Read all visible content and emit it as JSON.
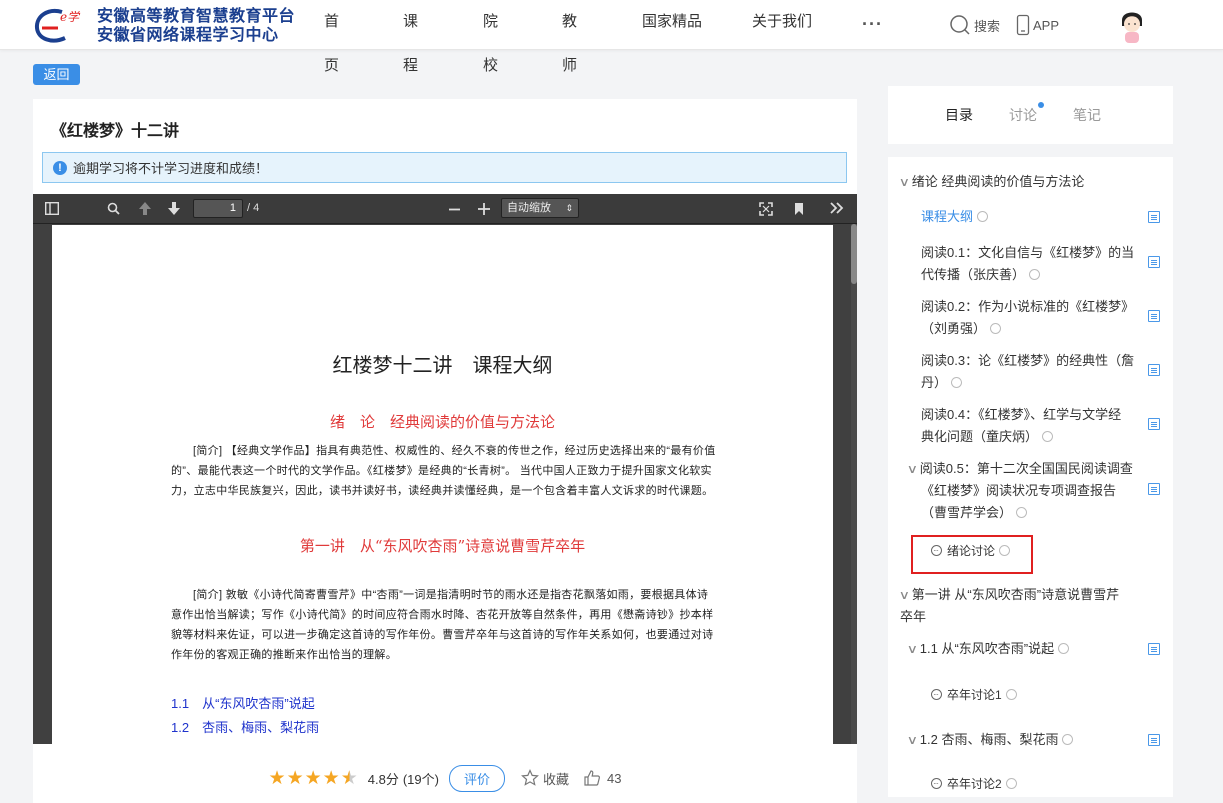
{
  "header": {
    "logo_line1": "安徽高等教育智慧教育平台",
    "logo_line2": "安徽省网络课程学习中心",
    "nav": [
      "首页",
      "课程",
      "院校",
      "教师",
      "国家精品",
      "关于我们"
    ],
    "more": "···",
    "search_label": "搜索",
    "app_label": "APP"
  },
  "back_label": "返回",
  "course": {
    "title": "《红楼梦》十二讲",
    "notice": "逾期学习将不计学习进度和成绩！"
  },
  "pdf": {
    "page_current": "1",
    "page_total": "/ 4",
    "zoom": "自动缩放",
    "doc_title": "红楼梦十二讲　课程大纲",
    "intro_heading": "绪　论　经典阅读的价值与方法论",
    "intro_para": "[简介] 【经典文学作品】指具有典范性、权威性的、经久不衰的传世之作，经过历史选择出来的“最有价值的”、最能代表这一个时代的文学作品。《红楼梦》是经典的“长青树”。 当代中国人正致力于提升国家文化软实力，立志中华民族复兴，因此，读书并读好书，读经典并读懂经典，是一个包含着丰富人文诉求的时代课题。",
    "lecture1_heading": "第一讲　从“东风吹杏雨”诗意说曹雪芹卒年",
    "lecture1_para": "[简介] 敦敏《小诗代简寄曹雪芹》中“杏雨”一词是指清明时节的雨水还是指杏花飘落如雨，要根据具体诗意作出恰当解读；写作《小诗代简》的时间应符合雨水时降、杏花开放等自然条件，再用《懋斋诗钞》抄本样貌等材料来佐证，可以进一步确定这首诗的写作年份。曹雪芹卒年与这首诗的写作年关系如何，也要通过对诗作年份的客观正确的推断来作出恰当的理解。",
    "toc1": "1.1　从“东风吹杏雨”说起",
    "toc2": "1.2　杏雨、梅雨、梨花雨"
  },
  "rating": {
    "score": "4.8分",
    "count": "(19个)",
    "rate_label": "评价",
    "fav_label": "收藏",
    "likes": "43",
    "stars_value": 4.5
  },
  "sidebar": {
    "tabs": [
      "目录",
      "讨论",
      "笔记"
    ],
    "catalog": {
      "intro_chapter": "绪论 经典阅读的价值与方法论",
      "syllabus": "课程大纲",
      "r01_a": "阅读0.1：文化自信与《红楼梦》的当",
      "r01_b": "代传播（张庆善）",
      "r02_a": "阅读0.2：作为小说标准的《红楼梦》",
      "r02_b": "（刘勇强）",
      "r03_a": "阅读0.3：论《红楼梦》的经典性（詹",
      "r03_b": "丹）",
      "r04_a": "阅读0.4：《红楼梦》、红学与文学经",
      "r04_b": "典化问题（童庆炳）",
      "r05_a": "阅读0.5：第十二次全国国民阅读调查",
      "r05_b": "《红楼梦》阅读状况专项调查报告",
      "r05_c": "（曹雪芹学会）",
      "intro_discussion": "绪论讨论",
      "ch1_a": "第一讲 从“东风吹杏雨”诗意说曹雪芹",
      "ch1_b": "卒年",
      "s11": "1.1 从“东风吹杏雨”说起",
      "s11_disc": "卒年讨论1",
      "s12": "1.2 杏雨、梅雨、梨花雨",
      "s12_disc": "卒年讨论2"
    }
  },
  "colors": {
    "accent": "#3a8ee6",
    "heading_red": "#e03a3a",
    "toc_blue": "#1f33cc",
    "star": "#f5a623",
    "highlight": "#e02020"
  }
}
